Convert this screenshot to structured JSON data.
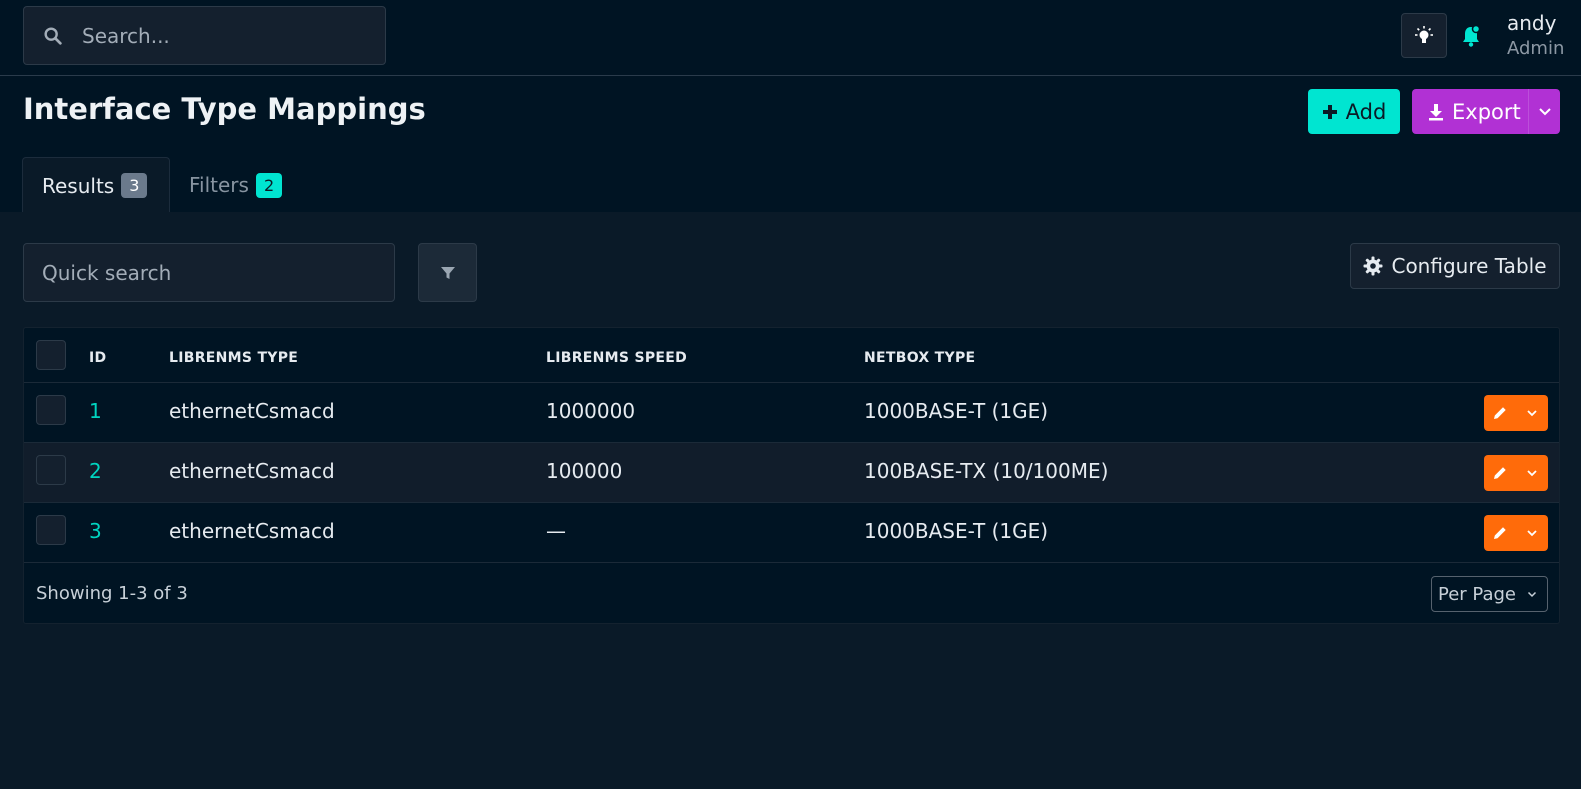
{
  "topbar": {
    "search_placeholder": "Search...",
    "user_name": "andy",
    "user_role": "Admin"
  },
  "header": {
    "title": "Interface Type Mappings",
    "add_label": "Add",
    "export_label": "Export"
  },
  "tabs": [
    {
      "label": "Results",
      "count": "3"
    },
    {
      "label": "Filters",
      "count": "2"
    }
  ],
  "toolbar": {
    "quick_search_placeholder": "Quick search",
    "configure_label": "Configure Table"
  },
  "table": {
    "columns": [
      "ID",
      "LIBRENMS TYPE",
      "LIBRENMS SPEED",
      "NETBOX TYPE"
    ],
    "rows": [
      {
        "id": "1",
        "librenms_type": "ethernetCsmacd",
        "librenms_speed": "1000000",
        "netbox_type": "1000BASE-T (1GE)"
      },
      {
        "id": "2",
        "librenms_type": "ethernetCsmacd",
        "librenms_speed": "100000",
        "netbox_type": "100BASE-TX (10/100ME)"
      },
      {
        "id": "3",
        "librenms_type": "ethernetCsmacd",
        "librenms_speed": "—",
        "netbox_type": "1000BASE-T (1GE)"
      }
    ],
    "footer": "Showing 1-3 of 3",
    "per_page_label": "Per Page"
  },
  "colors": {
    "background": "#001423",
    "accent_teal": "#00e5d1",
    "export_purple": "#b131d4",
    "action_orange": "#ff6b0a"
  },
  "icons": [
    "search-icon",
    "lightbulb-icon",
    "bell-icon",
    "plus-icon",
    "download-icon",
    "chevron-down-icon",
    "filter-icon",
    "gear-icon",
    "pencil-icon"
  ]
}
